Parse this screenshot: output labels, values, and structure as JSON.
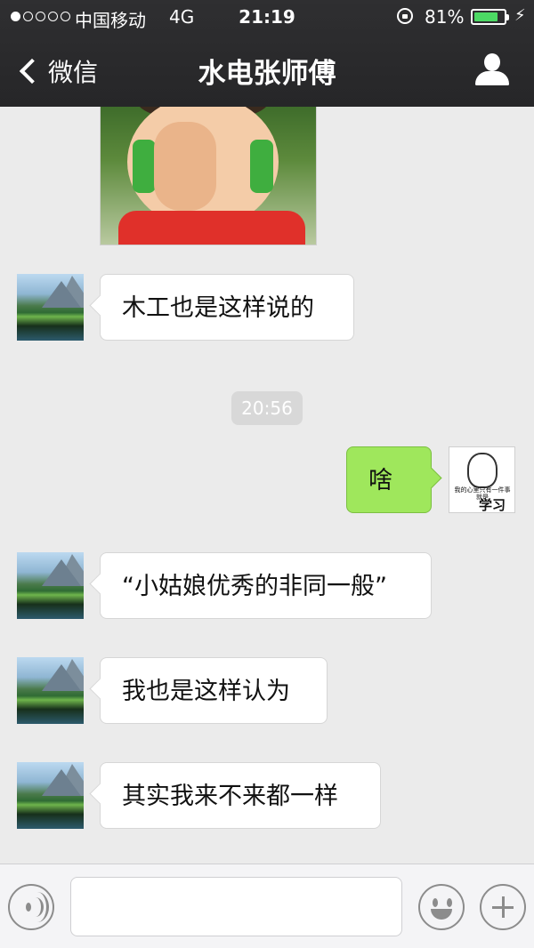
{
  "status_bar": {
    "carrier": "中国移动",
    "network": "4G",
    "time": "21:19",
    "battery_text": "81%",
    "battery_level": 0.81,
    "signal_strength": 1,
    "signal_max": 5,
    "icons": [
      "signal-dots-icon",
      "rotation-lock-icon",
      "battery-icon",
      "charging-bolt-icon"
    ]
  },
  "nav": {
    "back_label": "微信",
    "title": "水电张师傅",
    "icons": [
      "back-chevron-icon",
      "profile-icon"
    ]
  },
  "messages": [
    {
      "type": "image",
      "direction": "incoming",
      "description_icon": "thumbs-up-photo"
    },
    {
      "type": "text",
      "direction": "incoming",
      "text": "木工也是这样说的"
    },
    {
      "type": "timestamp",
      "text": "20:56"
    },
    {
      "type": "text",
      "direction": "outgoing",
      "text": "啥"
    },
    {
      "type": "text",
      "direction": "incoming",
      "text": "“小姑娘优秀的非同一般”"
    },
    {
      "type": "text",
      "direction": "incoming",
      "text": "我也是这样认为"
    },
    {
      "type": "text",
      "direction": "incoming",
      "text": "其实我来不来都一样"
    }
  ],
  "self_avatar": {
    "caption_small": "我的心里只有一件事 就是",
    "caption_big": "学习"
  },
  "input_bar": {
    "placeholder": "",
    "icons": [
      "voice-icon",
      "emoji-icon",
      "plus-icon"
    ]
  },
  "colors": {
    "outgoing_bubble": "#9fe75c",
    "incoming_bubble": "#ffffff",
    "battery_fill": "#4cd964",
    "header_bg": "#2a2a2c"
  }
}
